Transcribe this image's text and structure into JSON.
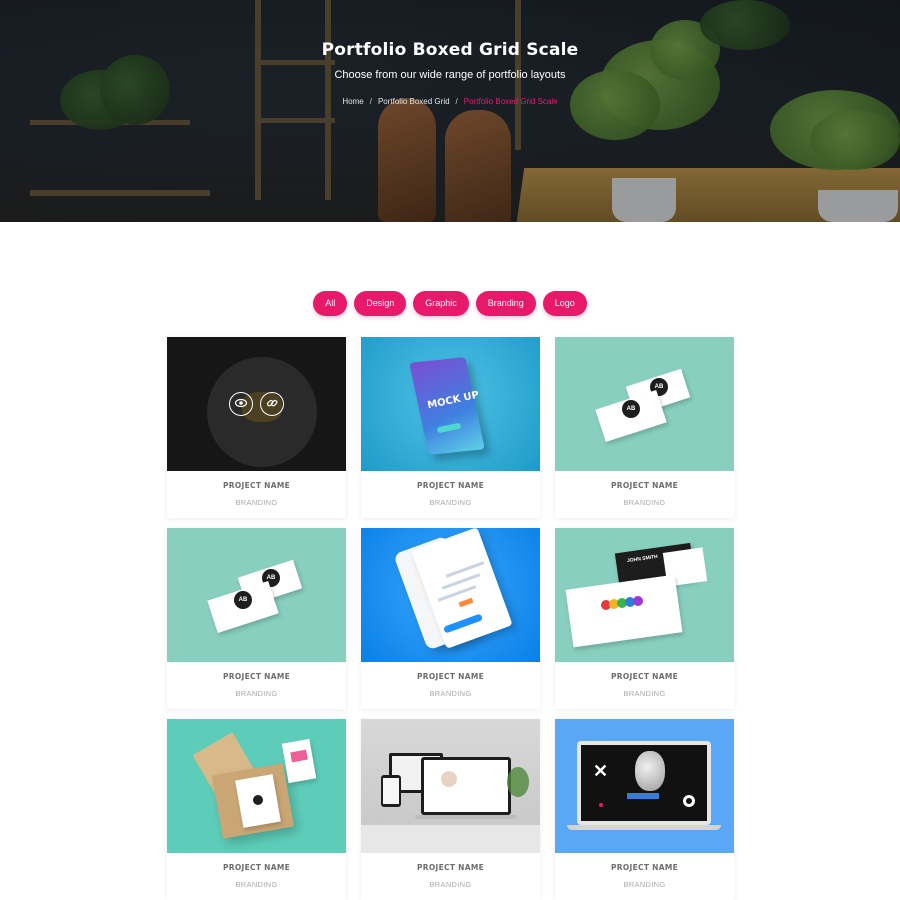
{
  "hero": {
    "title": "Portfolio Boxed Grid Scale",
    "subtitle": "Choose from our wide range of portfolio layouts",
    "breadcrumb": {
      "home": "Home",
      "parent": "Portfolio Boxed Grid",
      "current": "Portfolio Boxed Grid Scale"
    }
  },
  "filters": [
    "All",
    "Design",
    "Graphic",
    "Branding",
    "Logo"
  ],
  "accent_color": "#e8196a",
  "projects": [
    {
      "name": "PROJECT NAME",
      "category": "BRANDING",
      "thumb": "dark-plate-hover"
    },
    {
      "name": "PROJECT NAME",
      "category": "BRANDING",
      "thumb": "phone-mockup-blue",
      "mock_text": "MOCK UP"
    },
    {
      "name": "PROJECT NAME",
      "category": "BRANDING",
      "thumb": "business-cards-teal",
      "logo_text": "AB"
    },
    {
      "name": "PROJECT NAME",
      "category": "BRANDING",
      "thumb": "business-cards-teal",
      "logo_text": "AB"
    },
    {
      "name": "PROJECT NAME",
      "category": "BRANDING",
      "thumb": "app-screen-blue"
    },
    {
      "name": "PROJECT NAME",
      "category": "BRANDING",
      "thumb": "cards-color-dots",
      "card_text": "JOHN SMITH"
    },
    {
      "name": "PROJECT NAME",
      "category": "BRANDING",
      "thumb": "card-box-teal"
    },
    {
      "name": "PROJECT NAME",
      "category": "BRANDING",
      "thumb": "devices-grey"
    },
    {
      "name": "PROJECT NAME",
      "category": "BRANDING",
      "thumb": "laptop-blue"
    }
  ],
  "hover_icons": [
    "eye-icon",
    "link-icon"
  ]
}
